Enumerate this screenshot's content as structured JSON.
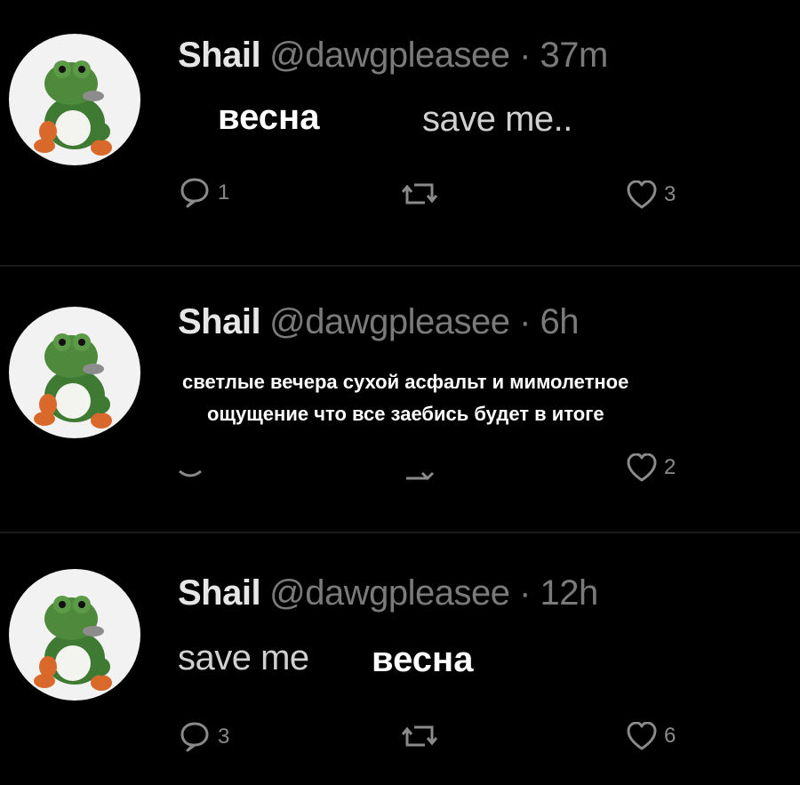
{
  "tweets": [
    {
      "name": "Shail",
      "handle": "@dawgpleasee",
      "separator": "·",
      "time": "37m",
      "caption": "весна",
      "text": "save me..",
      "replies": "1",
      "retweets": "",
      "likes": "3"
    },
    {
      "name": "Shail",
      "handle": "@dawgpleasee",
      "separator": "·",
      "time": "6h",
      "caption_line1": "светлые вечера  сухой асфальт и мимолетное",
      "caption_line2": "ощущение что все заебись будет в итоге",
      "likes": "2"
    },
    {
      "name": "Shail",
      "handle": "@dawgpleasee",
      "separator": "·",
      "time": "12h",
      "text": "save me",
      "caption": "весна",
      "replies": "3",
      "retweets": "",
      "likes": "6"
    }
  ],
  "colors": {
    "background": "#000000",
    "name": "#e6e6e6",
    "muted": "#7a7a7a",
    "caption": "#ffffff",
    "avatar_bg": "#f2f2f2",
    "frog_green": "#4f8a3c"
  },
  "icons": [
    "reply-icon",
    "retweet-icon",
    "like-icon",
    "frog-avatar"
  ]
}
